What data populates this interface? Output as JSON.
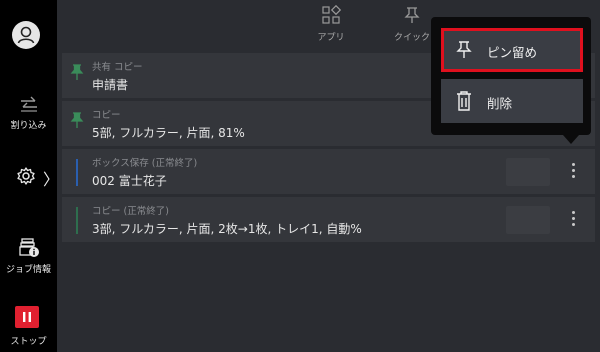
{
  "sidebar": {
    "interrupt_label": "割り込み",
    "job_info_label": "ジョブ情報",
    "stop_label": "ストップ"
  },
  "topnav": {
    "apps_label": "アプリ",
    "quick_label": "クイック"
  },
  "jobs": [
    {
      "sub": "共有 コピー",
      "main": "申請書",
      "strip_color": "#3a8c5a",
      "pinned": true
    },
    {
      "sub": "コピー",
      "main": "5部, フルカラー, 片面, 81%",
      "strip_color": "#3a8c5a",
      "pinned": true
    },
    {
      "sub": "ボックス保存 (正常終了)",
      "main": "002 富士花子",
      "strip_color": "#2a5fb0",
      "pinned": false
    },
    {
      "sub": "コピー (正常終了)",
      "main": "3部, フルカラー, 片面, 2枚→1枚, トレイ1, 自動%",
      "strip_color": "#2e6e4e",
      "pinned": false
    }
  ],
  "context_menu": {
    "pin_label": "ピン留め",
    "delete_label": "削除",
    "highlight_color": "#e0101e"
  },
  "colors": {
    "sidebar_bg": "#000000",
    "main_bg": "#2a2c31",
    "row_bg": "#34363b",
    "stop_red": "#e02030"
  }
}
